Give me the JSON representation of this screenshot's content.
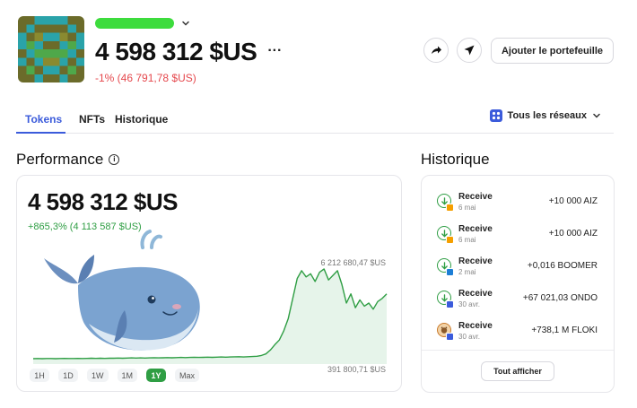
{
  "account": {
    "balance": "4 598 312 $US",
    "more_label": "···",
    "change": "-1% (46 791,78 $US)"
  },
  "actions": {
    "share_icon": "share-arrow-icon",
    "send_icon": "send-icon",
    "add_wallet_label": "Ajouter le portefeuille"
  },
  "tabs": [
    {
      "label": "Tokens",
      "active": true
    },
    {
      "label": "NFTs",
      "active": false
    },
    {
      "label": "Historique",
      "active": false
    }
  ],
  "network_selector": {
    "label": "Tous les réseaux"
  },
  "performance": {
    "title": "Performance",
    "value": "4 598 312 $US",
    "change": "+865,3% (4 113 587 $US)",
    "max_label": "6 212 680,47 $US",
    "min_label": "391 800,71 $US",
    "ranges": [
      {
        "label": "1H",
        "active": false
      },
      {
        "label": "1D",
        "active": false
      },
      {
        "label": "1W",
        "active": false
      },
      {
        "label": "1M",
        "active": false
      },
      {
        "label": "1Y",
        "active": true
      },
      {
        "label": "Max",
        "active": false
      }
    ]
  },
  "chart_data": {
    "type": "line",
    "x": [
      0,
      1,
      2,
      3,
      4,
      5,
      6,
      7,
      8,
      9,
      10,
      11,
      12,
      13,
      14,
      15,
      16,
      17,
      18,
      19,
      20,
      21,
      22,
      23,
      24,
      25,
      26,
      27,
      28,
      29,
      30,
      31,
      32,
      33,
      34,
      35,
      36,
      37,
      38,
      39,
      40,
      41,
      42,
      43,
      44,
      45,
      46,
      47,
      48,
      49,
      50,
      51,
      52,
      53,
      54,
      55,
      56,
      57,
      58,
      59,
      60,
      61,
      62,
      63,
      64,
      65,
      66,
      67,
      68,
      69,
      70,
      71,
      72,
      73,
      74,
      75,
      76,
      77,
      78,
      79
    ],
    "y": [
      0.39,
      0.4,
      0.39,
      0.4,
      0.4,
      0.39,
      0.4,
      0.41,
      0.4,
      0.4,
      0.41,
      0.4,
      0.41,
      0.42,
      0.41,
      0.42,
      0.41,
      0.42,
      0.42,
      0.43,
      0.42,
      0.43,
      0.44,
      0.43,
      0.44,
      0.43,
      0.44,
      0.45,
      0.44,
      0.45,
      0.46,
      0.45,
      0.46,
      0.47,
      0.46,
      0.47,
      0.48,
      0.47,
      0.48,
      0.49,
      0.48,
      0.49,
      0.5,
      0.49,
      0.5,
      0.51,
      0.52,
      0.5,
      0.52,
      0.53,
      0.55,
      0.6,
      0.7,
      0.95,
      1.3,
      1.6,
      2.2,
      3.0,
      4.3,
      5.6,
      6.1,
      5.7,
      5.9,
      5.4,
      6.0,
      6.21,
      5.5,
      5.8,
      6.1,
      5.2,
      4.0,
      4.6,
      3.7,
      4.2,
      3.8,
      4.0,
      3.6,
      4.1,
      4.3,
      4.6
    ],
    "ylim": [
      0.39,
      6.21
    ],
    "color": "#2f9e44",
    "fill": "#e6f4ea"
  },
  "history": {
    "title": "Historique",
    "items": [
      {
        "type": "Receive",
        "date": "6 mai",
        "amount": "+10 000 AIZ",
        "badge_color": "#f59f00"
      },
      {
        "type": "Receive",
        "date": "6 mai",
        "amount": "+10 000 AIZ",
        "badge_color": "#f59f00"
      },
      {
        "type": "Receive",
        "date": "2 mai",
        "amount": "+0,016 BOOMER",
        "badge_color": "#1c7ed6"
      },
      {
        "type": "Receive",
        "date": "30 avr.",
        "amount": "+67 021,03 ONDO",
        "badge_color": "#3b5bdb"
      },
      {
        "type": "Receive",
        "date": "30 avr.",
        "amount": "+738,1 M FLOKI",
        "badge_color": "#3b5bdb"
      }
    ],
    "show_all_label": "Tout afficher"
  }
}
